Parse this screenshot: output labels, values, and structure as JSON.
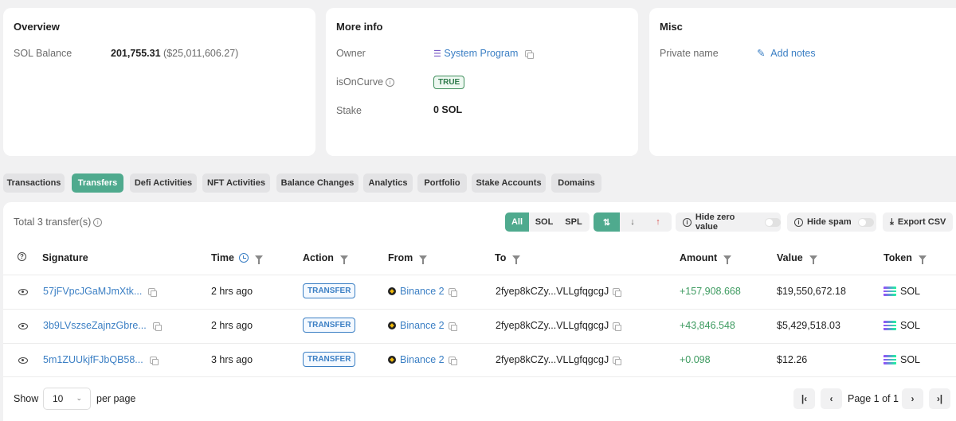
{
  "overview": {
    "title": "Overview",
    "balance_label": "SOL Balance",
    "balance_value": "201,755.31",
    "balance_usd": "($25,011,606.27)"
  },
  "more_info": {
    "title": "More info",
    "owner_label": "Owner",
    "owner_value": "System Program",
    "oncurve_label": "isOnCurve",
    "oncurve_value": "TRUE",
    "stake_label": "Stake",
    "stake_value": "0 SOL"
  },
  "misc": {
    "title": "Misc",
    "private_label": "Private name",
    "add_notes": "Add notes"
  },
  "tabs": [
    "Transactions",
    "Transfers",
    "Defi Activities",
    "NFT Activities",
    "Balance Changes",
    "Analytics",
    "Portfolio",
    "Stake Accounts",
    "Domains"
  ],
  "toolbar": {
    "total": "Total 3 transfer(s)",
    "filter_all": "All",
    "filter_sol": "SOL",
    "filter_spl": "SPL",
    "hide_zero": "Hide zero value",
    "hide_spam": "Hide spam",
    "export": "Export CSV"
  },
  "columns": {
    "signature": "Signature",
    "time": "Time",
    "action": "Action",
    "from": "From",
    "to": "To",
    "amount": "Amount",
    "value": "Value",
    "token": "Token"
  },
  "rows": [
    {
      "signature": "57jFVpcJGaMJmXtk...",
      "time": "2 hrs ago",
      "action": "TRANSFER",
      "from": "Binance 2",
      "to": "2fyep8kCZy...VLLgfqgcgJ",
      "amount": "+157,908.668",
      "value": "$19,550,672.18",
      "token": "SOL"
    },
    {
      "signature": "3b9LVszseZajnzGbre...",
      "time": "2 hrs ago",
      "action": "TRANSFER",
      "from": "Binance 2",
      "to": "2fyep8kCZy...VLLgfqgcgJ",
      "amount": "+43,846.548",
      "value": "$5,429,518.03",
      "token": "SOL"
    },
    {
      "signature": "5m1ZUUkjfFJbQB58...",
      "time": "3 hrs ago",
      "action": "TRANSFER",
      "from": "Binance 2",
      "to": "2fyep8kCZy...VLLgfqgcgJ",
      "amount": "+0.098",
      "value": "$12.26",
      "token": "SOL"
    }
  ],
  "pagination": {
    "show_label": "Show",
    "page_size": "10",
    "per_page": "per page",
    "page_text": "Page 1 of 1"
  }
}
